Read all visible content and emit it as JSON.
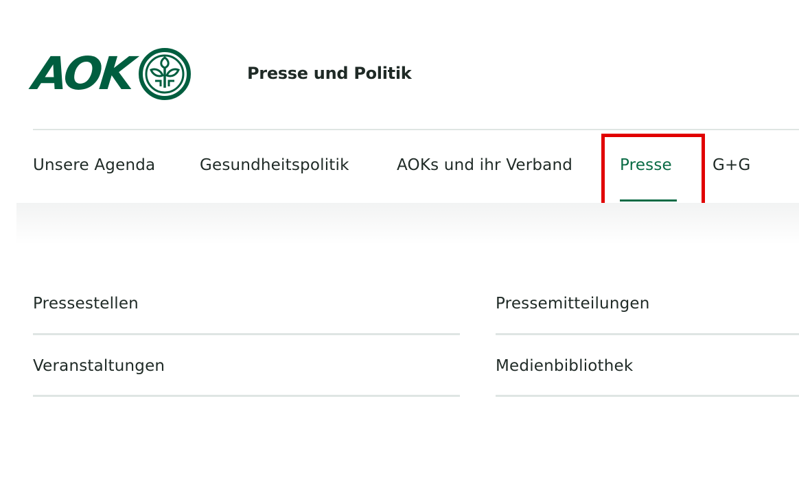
{
  "header": {
    "logo_text": "AOK",
    "title": "Presse und Politik"
  },
  "nav": {
    "items": [
      {
        "label": "Unsere Agenda"
      },
      {
        "label": "Gesundheitspolitik"
      },
      {
        "label": "AOKs und ihr Verband"
      },
      {
        "label": "Presse",
        "active": true
      },
      {
        "label": "G+G"
      }
    ]
  },
  "submenu": {
    "items": [
      {
        "label": "Pressestellen"
      },
      {
        "label": "Pressemitteilungen"
      },
      {
        "label": "Veranstaltungen"
      },
      {
        "label": "Medienbibliothek"
      }
    ]
  },
  "colors": {
    "brand": "#005e3f",
    "active": "#0a6b45",
    "highlight": "#e10000"
  },
  "icons": {
    "logo_emblem": "aok-tree-emblem-icon"
  }
}
